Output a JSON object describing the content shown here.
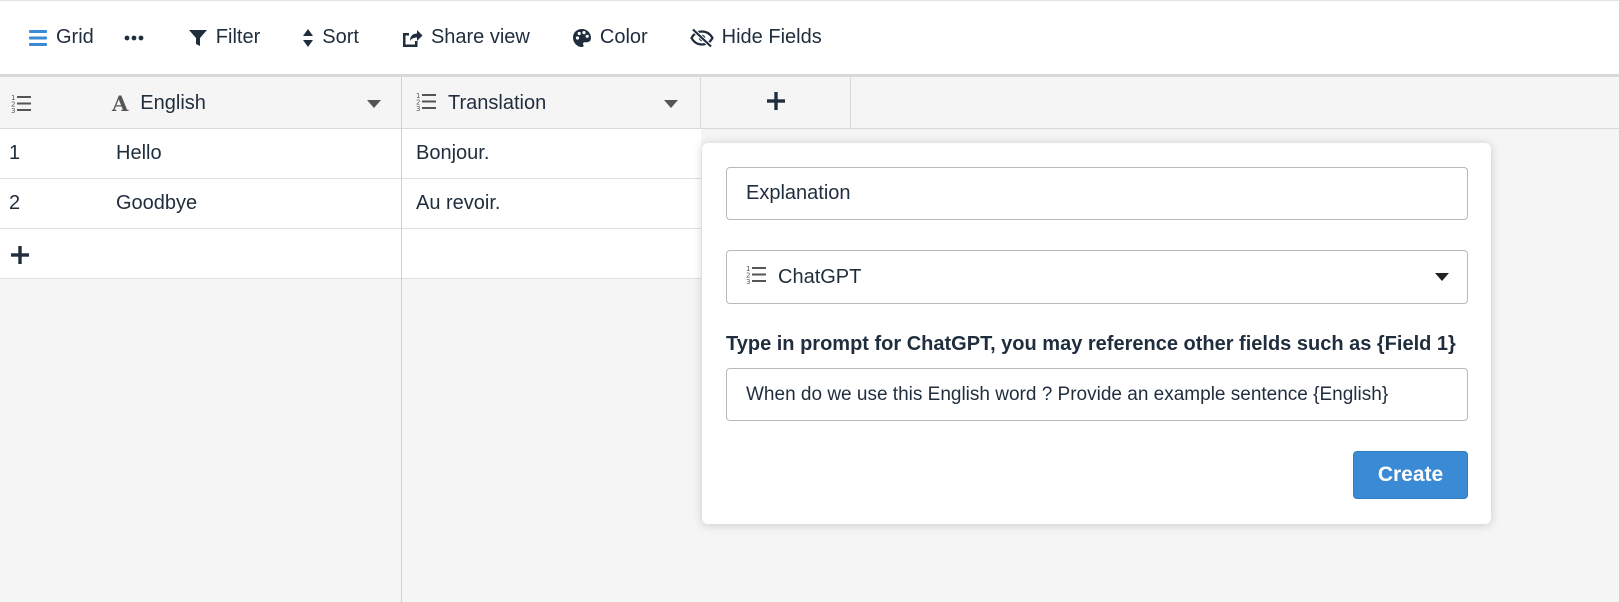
{
  "toolbar": {
    "grid_label": "Grid",
    "filter_label": "Filter",
    "sort_label": "Sort",
    "share_label": "Share view",
    "color_label": "Color",
    "hide_label": "Hide Fields"
  },
  "grid": {
    "columns": [
      {
        "name": "English",
        "icon": "text-type-icon"
      },
      {
        "name": "Translation",
        "icon": "list-type-icon"
      }
    ],
    "rows": [
      {
        "id": "1",
        "english": "Hello",
        "translation": "Bonjour."
      },
      {
        "id": "2",
        "english": "Goodbye",
        "translation": "Au revoir."
      }
    ]
  },
  "new_field_panel": {
    "name_value": "Explanation",
    "type_selected": "ChatGPT",
    "prompt_label": "Type in prompt for ChatGPT, you may reference other fields such as {Field 1}",
    "prompt_value": "When do we use this English word ? Provide an example sentence {English}",
    "create_label": "Create"
  },
  "colors": {
    "accent": "#3a8ad6",
    "text": "#1f2d3d",
    "background": "#f5f5f5"
  }
}
